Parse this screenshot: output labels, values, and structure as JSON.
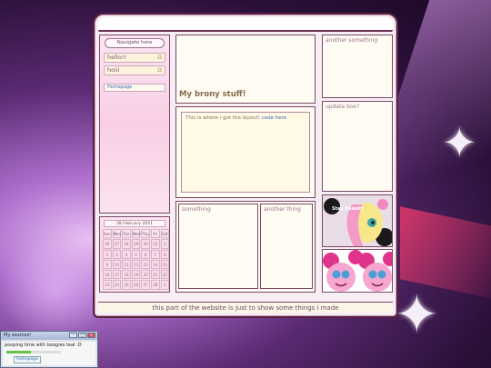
{
  "navigation": {
    "header": "Navigate here",
    "items": [
      {
        "label": "hello!!",
        "icon": "bell-icon"
      },
      {
        "label": "hoiii",
        "icon": "bell-icon"
      }
    ],
    "link": "Homepage"
  },
  "calendar": {
    "title": "28 February 2021",
    "weekdays": [
      "Sun",
      "Mon",
      "Tue",
      "Wed",
      "Thu",
      "Fri",
      "Sat"
    ],
    "days": [
      "26",
      "27",
      "28",
      "29",
      "30",
      "31",
      "1",
      "2",
      "3",
      "4",
      "5",
      "6",
      "7",
      "8",
      "9",
      "10",
      "11",
      "12",
      "13",
      "14",
      "15",
      "16",
      "17",
      "18",
      "19",
      "20",
      "21",
      "22",
      "23",
      "24",
      "25",
      "26",
      "27",
      "28",
      "1"
    ]
  },
  "main": {
    "title": "My brony stuff!",
    "layout_text": "This is where i got the layout!",
    "layout_link": "code here",
    "box_something": "something",
    "box_another_thing": "another thing"
  },
  "right": {
    "another_something": "another something",
    "update_box": "update box?",
    "sticker1_caption": "Stay Kawaii!"
  },
  "footer": {
    "text": "this part of the website is just to show some things i made"
  },
  "mini_window": {
    "title": "My sources!",
    "text": "pooping time with boogies teal :D",
    "link": "homepage",
    "progress_percent": 45
  },
  "colors": {
    "frame_border": "#5a2040",
    "panel_cream": "#fffdf3",
    "pink_panel": "#f9cfe6",
    "link_blue": "#3a6ab0"
  }
}
